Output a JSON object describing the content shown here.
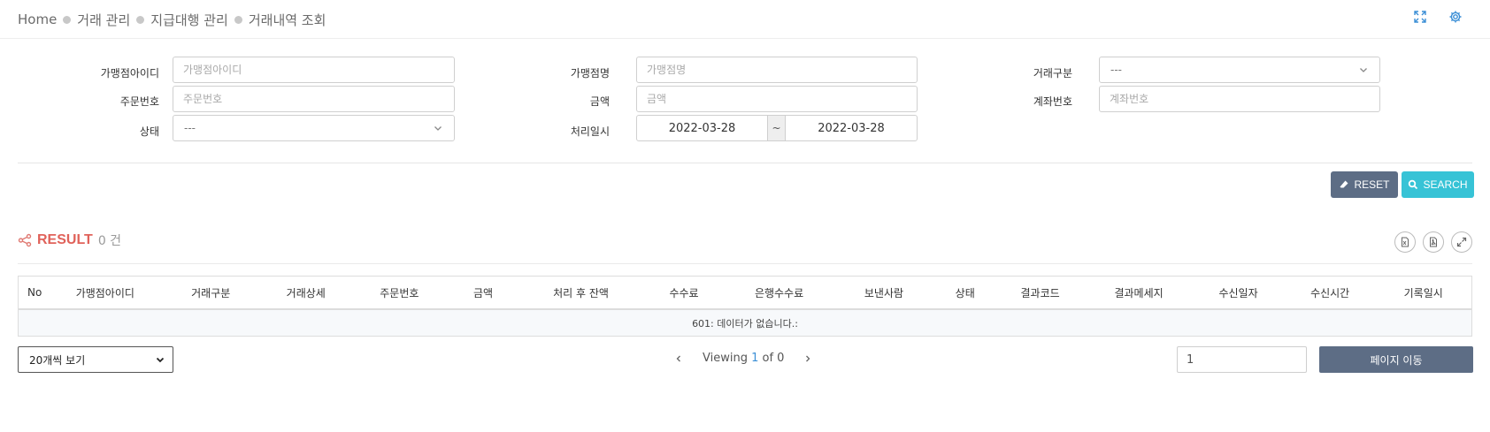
{
  "breadcrumb": [
    "Home",
    "거래 관리",
    "지급대행 관리",
    "거래내역 조회"
  ],
  "filters": {
    "merchant_id_label": "가맹점아이디",
    "merchant_id_placeholder": "가맹점아이디",
    "merchant_name_label": "가맹점명",
    "merchant_name_placeholder": "가맹점명",
    "trade_type_label": "거래구분",
    "trade_type_value": "---",
    "order_no_label": "주문번호",
    "order_no_placeholder": "주문번호",
    "amount_label": "금액",
    "amount_placeholder": "금액",
    "account_no_label": "계좌번호",
    "account_no_placeholder": "계좌번호",
    "status_label": "상태",
    "status_value": "---",
    "processed_at_label": "처리일시",
    "date_from": "2022-03-28",
    "date_sep": "~",
    "date_to": "2022-03-28"
  },
  "actions": {
    "reset_label": "RESET",
    "search_label": "SEARCH"
  },
  "result": {
    "title": "RESULT",
    "count": "0 건"
  },
  "table": {
    "columns": [
      "No",
      "가맹점아이디",
      "거래구분",
      "거래상세",
      "주문번호",
      "금액",
      "처리 후 잔액",
      "수수료",
      "은행수수료",
      "보낸사람",
      "상태",
      "결과코드",
      "결과메세지",
      "수신일자",
      "수신시간",
      "기록일시"
    ],
    "empty_message": "601: 데이터가 없습니다.:"
  },
  "pagination": {
    "page_size_label": "20개씩 보기",
    "viewing_prefix": "Viewing",
    "current_page": "1",
    "of_text": "of 0",
    "page_input_value": "1",
    "go_label": "페이지 이동"
  },
  "colors": {
    "accent": "#3b8fd6",
    "result_red": "#e0625a",
    "reset_bg": "#5d6d85",
    "search_bg": "#37c3d6"
  }
}
